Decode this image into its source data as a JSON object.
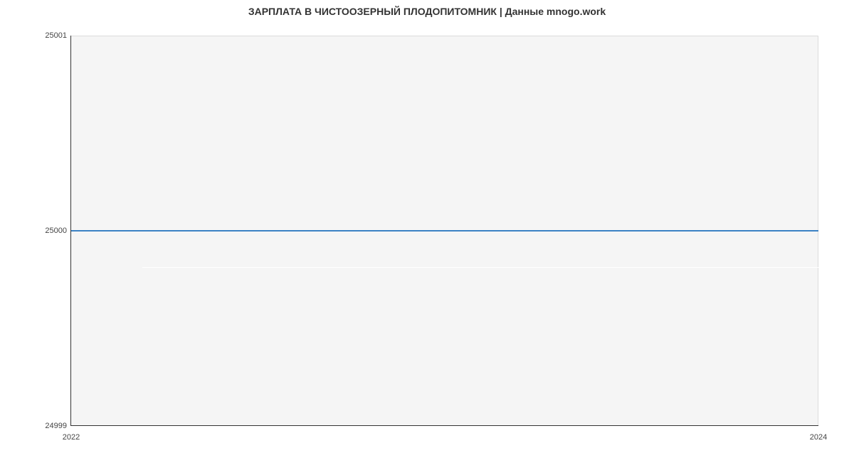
{
  "chart_data": {
    "type": "line",
    "title": "ЗАРПЛАТА В ЧИСТООЗЕРНЫЙ ПЛОДОПИТОМНИК | Данные mnogo.work",
    "xlabel": "",
    "ylabel": "",
    "x": [
      2022,
      2024
    ],
    "values": [
      25000,
      25000
    ],
    "ylim": [
      24999,
      25001
    ],
    "xlim": [
      2022,
      2024
    ],
    "y_ticks": [
      24999,
      25000,
      25001
    ],
    "x_ticks": [
      2022,
      2024
    ],
    "line_color": "#3b82c4",
    "plot_bg": "#f5f5f5"
  },
  "labels": {
    "y_25001": "25001",
    "y_25000": "25000",
    "y_24999": "24999",
    "x_2022": "2022",
    "x_2024": "2024"
  }
}
